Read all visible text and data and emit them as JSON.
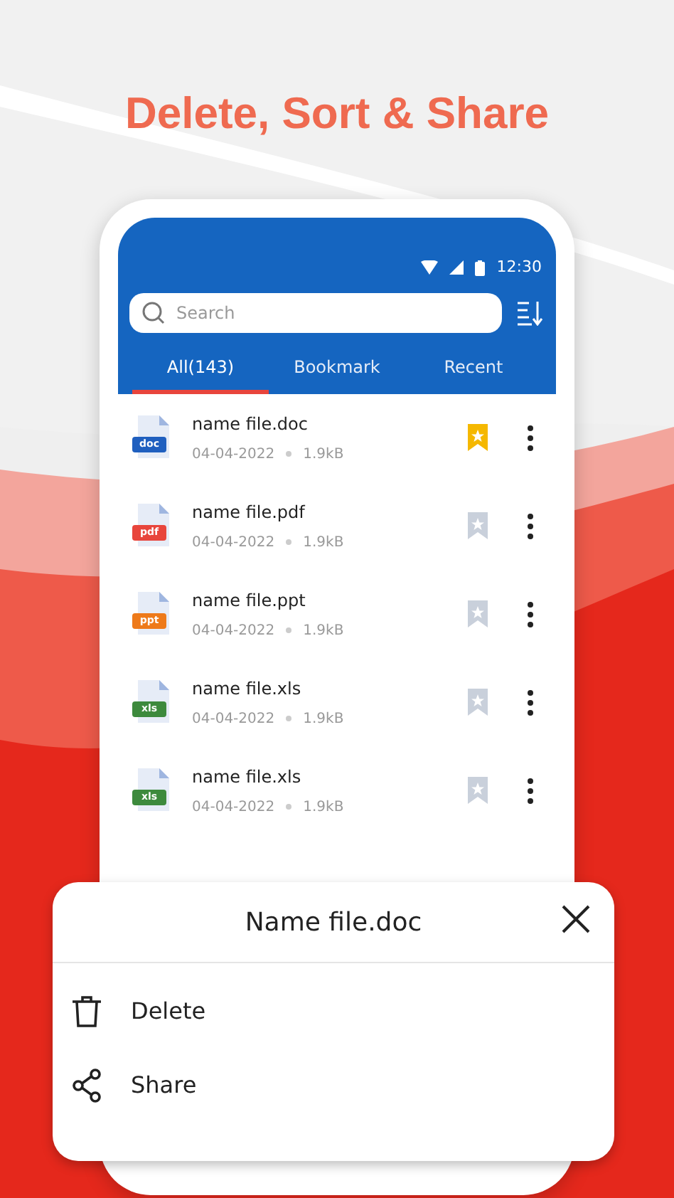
{
  "headline": "Delete, Sort & Share",
  "status_bar": {
    "time": "12:30"
  },
  "search": {
    "placeholder": "Search"
  },
  "tabs": [
    {
      "label": "All(143)",
      "selected": true
    },
    {
      "label": "Bookmark",
      "selected": false
    },
    {
      "label": "Recent",
      "selected": false
    }
  ],
  "files": [
    {
      "kind": "doc",
      "type_label": "doc",
      "name": "name file.doc",
      "date": "04-04-2022",
      "size": "1.9kB",
      "bookmarked": true
    },
    {
      "kind": "pdf",
      "type_label": "pdf",
      "name": "name file.pdf",
      "date": "04-04-2022",
      "size": "1.9kB",
      "bookmarked": false
    },
    {
      "kind": "ppt",
      "type_label": "ppt",
      "name": "name file.ppt",
      "date": "04-04-2022",
      "size": "1.9kB",
      "bookmarked": false
    },
    {
      "kind": "xls",
      "type_label": "xls",
      "name": "name file.xls",
      "date": "04-04-2022",
      "size": "1.9kB",
      "bookmarked": false
    },
    {
      "kind": "xls",
      "type_label": "xls",
      "name": "name file.xls",
      "date": "04-04-2022",
      "size": "1.9kB",
      "bookmarked": false
    }
  ],
  "sheet": {
    "title": "Name file.doc",
    "actions": [
      {
        "kind": "delete",
        "label": "Delete"
      },
      {
        "kind": "share",
        "label": "Share"
      }
    ]
  }
}
